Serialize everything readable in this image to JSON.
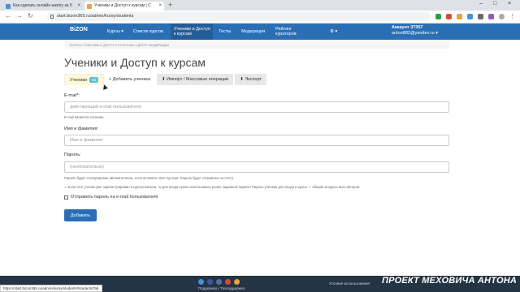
{
  "browser": {
    "tabs": [
      {
        "title": "Как сделать онлайн-школу за 5",
        "active": false
      },
      {
        "title": "Ученики и Доступ к курсам | С",
        "active": true
      }
    ],
    "url": "start.bizon365.ru/admin/kursy/students",
    "window_controls": [
      "–",
      "□",
      "×"
    ]
  },
  "topnav": {
    "logo": "BiZON",
    "items": [
      {
        "label": "Курсы ▾",
        "active": false
      },
      {
        "label": "Список курсов",
        "active": false
      },
      {
        "label": "Ученики и Доступ к курсам",
        "active": true
      },
      {
        "label": "Тесты",
        "active": false
      },
      {
        "label": "Модерация",
        "active": false
      },
      {
        "label": "Рейтинг кураторов",
        "active": false
      },
      {
        "label": "⚙ ▾",
        "active": false
      }
    ],
    "account_label": "Аккаунт 37357",
    "account_email": "anton882@yandex.ru ▾"
  },
  "breadcrumb": "КУРСЫ  /  УЧЕНИКИ И ДОСТУП К КУРСАМ  /  ЦЕНТР МОДЕРАЦИИ",
  "page_title": "Ученики и Доступ к курсам",
  "tabs": [
    {
      "label": "Ученики",
      "badge": "93"
    },
    {
      "label": "+ Добавить ученика"
    },
    {
      "label": "⬆ Импорт / Массовые операции"
    },
    {
      "label": "⬇ Экспорт"
    }
  ],
  "form": {
    "email_label": "E-mail*:",
    "email_placeholder": "действующий e-mail пользователя",
    "email_help": "E-mail является логином.",
    "name_label": "Имя и фамилия:",
    "name_placeholder": "Имя и фамилия",
    "password_label": "Пароль:",
    "password_placeholder": "(необязательно)",
    "password_help": "Пароль будет сгенерирован автоматически, если оставить поле пустым. Пароль будет отправлен на почту.",
    "warning": "⚠ Если этот ученик уже зарегистрирован в курсах Бизона, то для входа нужно использовать ранее заданный пароль! Пароль ученика для входа в курсы — общий на курсы всех авторов.",
    "send_password_label": "Отправить пароль на e-mail пользователя",
    "submit_label": "Добавить"
  },
  "footer": {
    "left_text": "Поддержка / Техподдержка",
    "right_text": "Условия использования"
  },
  "status_bar": "https://start.bizon365.ru/admin/kursy/students#studentsTab",
  "watermark": "ПРОЕКТ МЕХОВИЧА АНТОНА",
  "colors": {
    "nav": "#2a6fb5",
    "footer": "#243444",
    "badge": "#5bc0de"
  }
}
